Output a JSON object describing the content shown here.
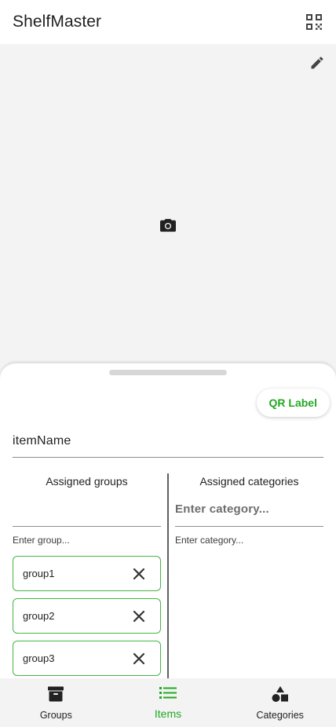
{
  "app": {
    "title": "ShelfMaster"
  },
  "icons": {
    "qr": "qr-code-icon",
    "edit": "pencil-icon",
    "camera": "camera-icon",
    "remove": "close-icon",
    "groups": "archive-box-icon",
    "items": "list-icon",
    "categories": "shapes-icon"
  },
  "colors": {
    "accent": "#22a822",
    "chip_border": "#46b546",
    "photo_bg": "#f3f3f3",
    "nav_bg": "#f3f3f3"
  },
  "sheet": {
    "qr_label_button": "QR Label",
    "item_name": "itemName",
    "groups": {
      "header": "Assigned groups",
      "input_value": "",
      "helper": "Enter group...",
      "chips": [
        "group1",
        "group2",
        "group3"
      ]
    },
    "categories": {
      "header": "Assigned categories",
      "placeholder": "Enter category...",
      "helper": "Enter category..."
    }
  },
  "nav": {
    "active": "Items",
    "items": [
      {
        "label": "Groups"
      },
      {
        "label": "Items"
      },
      {
        "label": "Categories"
      }
    ]
  }
}
